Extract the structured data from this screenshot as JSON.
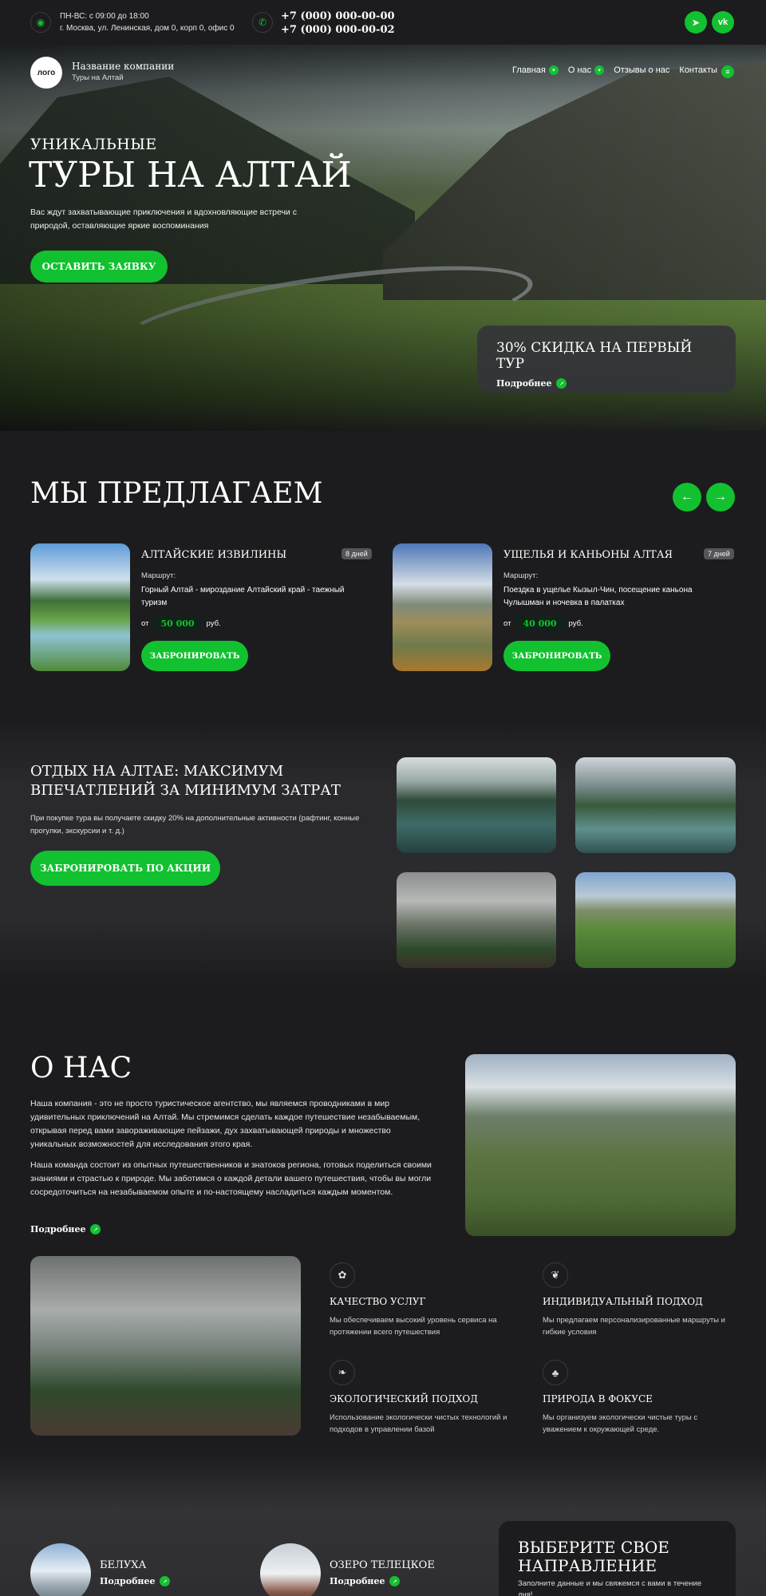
{
  "topbar": {
    "hours": "ПН-ВС: с 09:00 до 18:00",
    "address": "г. Москва, ул. Ленинская, дом 0, корп 0, офис 0",
    "phone1": "+7 (000) 000-00-00",
    "phone2": "+7 (000) 000-00-02",
    "telegram_icon": "telegram-icon",
    "vk_label": "vk"
  },
  "header": {
    "logo": "лого",
    "company_name": "Название компании",
    "tagline": "Туры на Алтай",
    "nav": [
      {
        "label": "Главная"
      },
      {
        "label": "О нас"
      },
      {
        "label": "Отзывы о нас"
      },
      {
        "label": "Контакты"
      }
    ]
  },
  "hero": {
    "kicker": "УНИКАЛЬНЫЕ",
    "title": "ТУРЫ НА АЛТАЙ",
    "subtitle": "Вас ждут захватывающие приключения и вдохновляющие встречи с природой, оставляющие яркие воспоминания",
    "cta": "ОСТАВИТЬ ЗАЯВКУ",
    "promo_title": "30% СКИДКА НА ПЕРВЫЙ ТУР",
    "promo_link": "Подробнее"
  },
  "offers": {
    "title": "МЫ ПРЕДЛАГАЕМ",
    "route_label": "Маршрут:",
    "price_prefix": "от",
    "currency": "руб.",
    "cards": [
      {
        "title": "АЛТАЙСКИЕ ИЗВИЛИНЫ",
        "days": "8 дней",
        "route": "Горный Алтай - мироздание Алтайский край - таежный туризм",
        "price": "50 000",
        "button": "ЗАБРОНИРОВАТЬ"
      },
      {
        "title": "УЩЕЛЬЯ И КАНЬОНЫ АЛТАЯ",
        "days": "7 дней",
        "route": "Поездка в ущелье Кызыл-Чин, посещение каньона Чулышман и ночевка в палатках",
        "price": "40 000",
        "button": "ЗАБРОНИРОВАТЬ"
      }
    ]
  },
  "deal": {
    "title_line1": "ОТДЫХ НА АЛТАЕ: МАКСИМУМ",
    "title_line2": "ВПЕЧАТЛЕНИЙ ЗА МИНИМУМ ЗАТРАТ",
    "text": "При покупке тура вы получаете скидку 20% на дополнительные активности (рафтинг, конные прогулки, экскурсии и т. д.)",
    "cta": "ЗАБРОНИРОВАТЬ ПО АКЦИИ"
  },
  "about": {
    "title": "О НАС",
    "p1": "Наша компания - это не просто туристическое агентство, мы являемся проводниками в мир удивительных приключений на Алтай. Мы стремимся сделать каждое путешествие незабываемым, открывая перед вами завораживающие пейзажи, дух захватывающей природы и множество уникальных возможностей для исследования этого края.",
    "p2": "Наша команда состоит из опытных путешественников и знатоков региона, готовых поделиться своими знаниями и страстью к природе. Мы заботимся о каждой детали вашего путешествия, чтобы вы могли сосредоточиться на незабываемом опыте и по-настоящему насладиться каждым моментом.",
    "link": "Подробнее",
    "features": [
      {
        "title": "КАЧЕСТВО УСЛУГ",
        "text": "Мы обеспечиваем высокий уровень сервиса на протяжении всего путешествия",
        "icon": "quality-icon"
      },
      {
        "title": "ИНДИВИДУАЛЬНЫЙ ПОДХОД",
        "text": "Мы предлагаем персонализированные маршруты и гибкие условия",
        "icon": "hands-icon"
      },
      {
        "title": "ЭКОЛОГИЧЕСКИЙ ПОДХОД",
        "text": "Использование экологически чистых технологий и подходов в управлении базой",
        "icon": "eco-icon"
      },
      {
        "title": "ПРИРОДА В ФОКУСЕ",
        "text": "Мы организуем экологически чистые туры с уважением к окружающей среде.",
        "icon": "trees-icon"
      }
    ]
  },
  "directions": {
    "items": [
      {
        "title": "БЕЛУХА",
        "link": "Подробнее"
      },
      {
        "title": "ОЗЕРО ТЕЛЕЦКОЕ",
        "link": "Подробнее"
      }
    ],
    "form_title_line1": "ВЫБЕРИТЕ СВОЕ",
    "form_title_line2": "НАПРАВЛЕНИЕ",
    "form_text": "Заполните данные и мы свяжемся с вами в течение дня!"
  }
}
